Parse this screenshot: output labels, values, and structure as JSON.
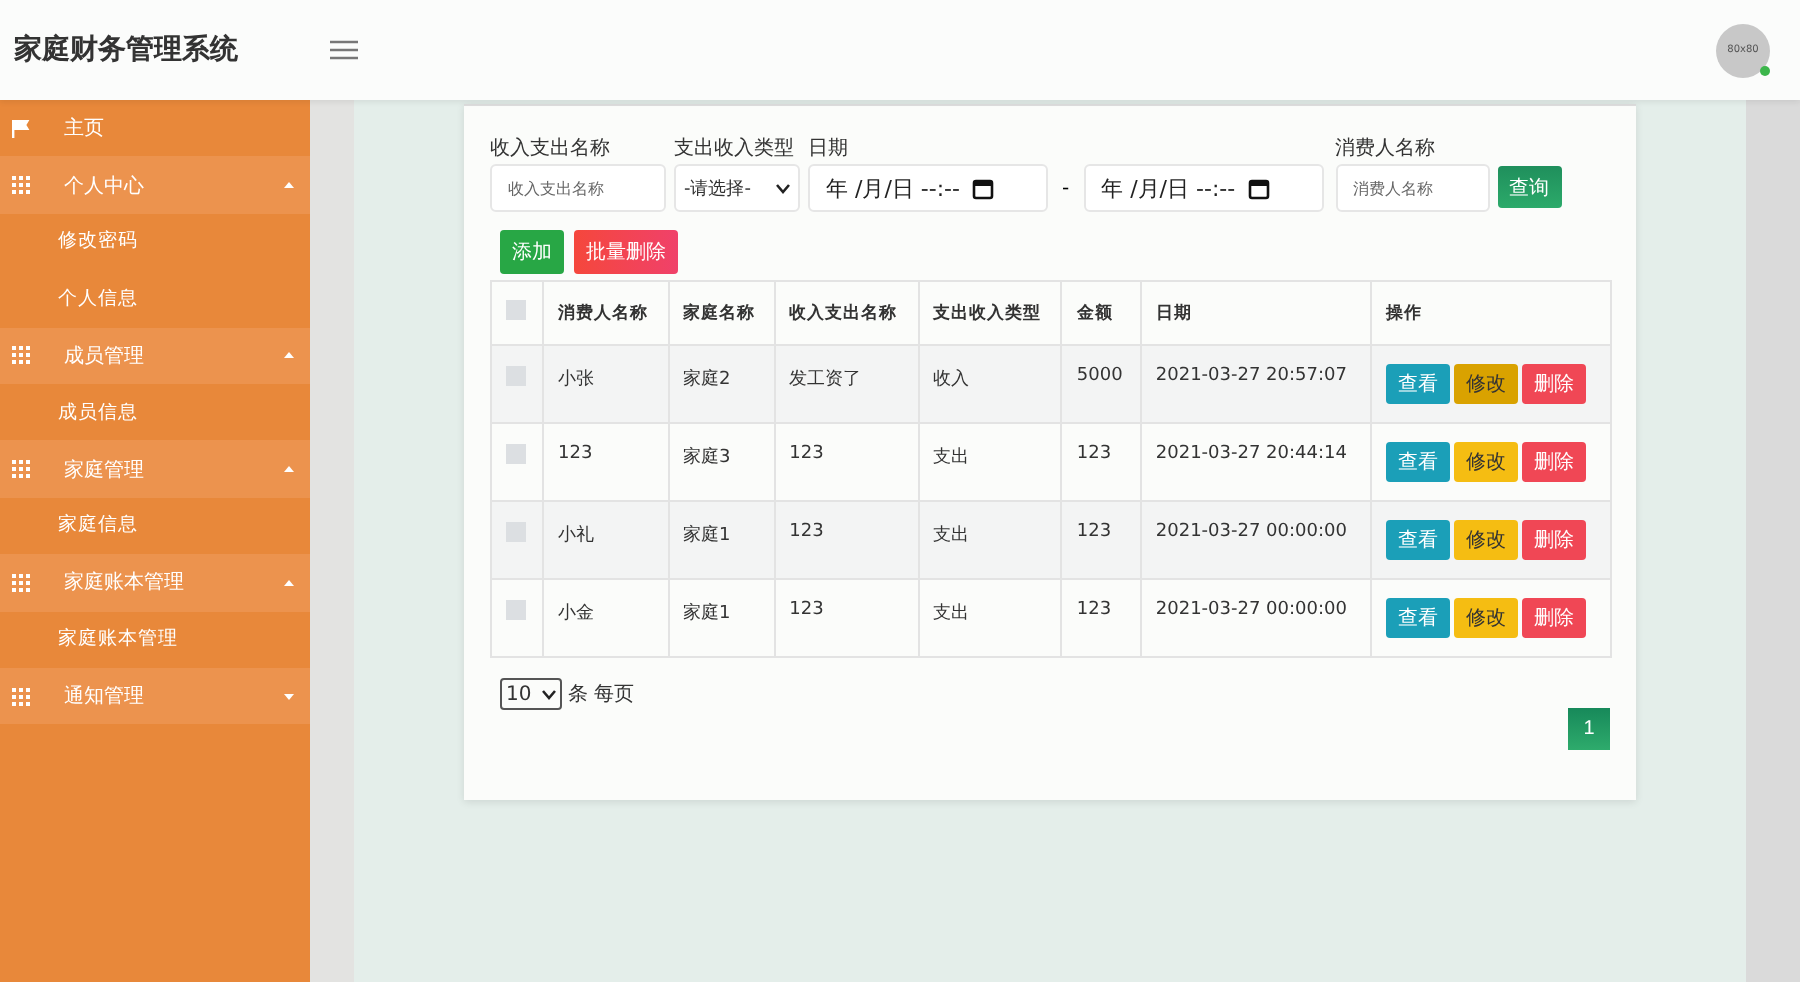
{
  "header": {
    "title": "家庭财务管理系统",
    "avatar_text": "80x80",
    "online": true
  },
  "sidebar": {
    "items": [
      {
        "kind": "link",
        "label": "主页"
      },
      {
        "kind": "group",
        "label": "个人中心",
        "expanded": true,
        "children": [
          {
            "label": "修改密码"
          },
          {
            "label": "个人信息"
          }
        ]
      },
      {
        "kind": "group",
        "label": "成员管理",
        "expanded": true,
        "children": [
          {
            "label": "成员信息"
          }
        ]
      },
      {
        "kind": "group",
        "label": "家庭管理",
        "expanded": true,
        "children": [
          {
            "label": "家庭信息"
          }
        ]
      },
      {
        "kind": "group",
        "label": "家庭账本管理",
        "expanded": true,
        "children": [
          {
            "label": "家庭账本管理"
          }
        ]
      },
      {
        "kind": "group",
        "label": "通知管理",
        "expanded": false
      }
    ]
  },
  "filters": {
    "name_label": "收入支出名称",
    "name_placeholder": "收入支出名称",
    "type_label": "支出收入类型",
    "type_value": "-请选择-",
    "date_label": "日期",
    "date_from": "年 /月/日 --:--",
    "date_sep": "-",
    "date_to": "年 /月/日 --:--",
    "consumer_label": "消费人名称",
    "consumer_placeholder": "消费人名称",
    "search_button": "查询"
  },
  "actions": {
    "add": "添加",
    "batch_delete": "批量删除"
  },
  "table": {
    "header_checked": false,
    "columns": [
      "消费人名称",
      "家庭名称",
      "收入支出名称",
      "支出收入类型",
      "金额",
      "日期",
      "操作"
    ],
    "rows": [
      {
        "checked": false,
        "cells": [
          "小张",
          "家庭2",
          "发工资了",
          "收入",
          "5000",
          "2021-03-27 20:57:07"
        ],
        "buttons": [
          "查看",
          "修改",
          "删除"
        ],
        "edit_hovered": true
      },
      {
        "checked": false,
        "cells": [
          "123",
          "家庭3",
          "123",
          "支出",
          "123",
          "2021-03-27 20:44:14"
        ],
        "buttons": [
          "查看",
          "修改",
          "删除"
        ],
        "edit_hovered": false
      },
      {
        "checked": false,
        "cells": [
          "小礼",
          "家庭1",
          "123",
          "支出",
          "123",
          "2021-03-27 00:00:00"
        ],
        "buttons": [
          "查看",
          "修改",
          "删除"
        ],
        "edit_hovered": false
      },
      {
        "checked": false,
        "cells": [
          "小金",
          "家庭1",
          "123",
          "支出",
          "123",
          "2021-03-27 00:00:00"
        ],
        "buttons": [
          "查看",
          "修改",
          "删除"
        ],
        "edit_hovered": false
      }
    ]
  },
  "pagination": {
    "page_size": "10",
    "page_size_label": "条 每页",
    "pages": [
      {
        "label": "1",
        "selected": true
      }
    ]
  }
}
